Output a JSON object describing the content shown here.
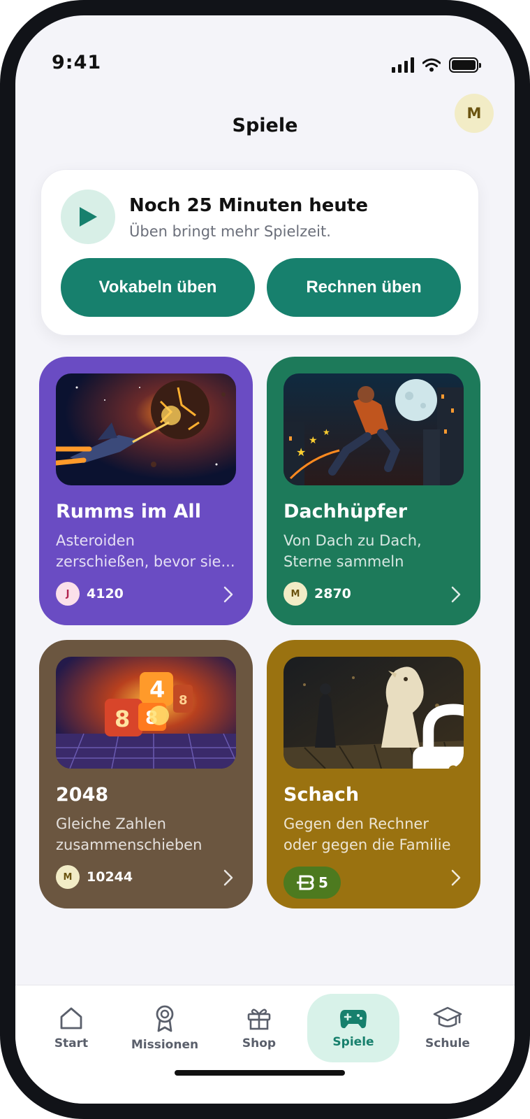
{
  "status_bar": {
    "time": "9:41"
  },
  "header": {
    "title": "Spiele",
    "avatar_initial": "M"
  },
  "time_card": {
    "title": "Noch 25 Minuten heute",
    "subtitle": "Üben bringt mehr Spielzeit.",
    "buttons": [
      {
        "label": "Vokabeln üben"
      },
      {
        "label": "Rechnen üben"
      }
    ]
  },
  "games": [
    {
      "title": "Rumms im All",
      "desc_line1": "Asteroiden",
      "desc_line2": "zerschießen, bevor sie...",
      "score_avatar": "J",
      "score": "4120",
      "color": "#6a4cc3"
    },
    {
      "title": "Dachhüpfer",
      "desc_line1": "Von Dach zu Dach,",
      "desc_line2": "Sterne sammeln",
      "score_avatar": "M",
      "score": "2870",
      "color": "#1d7a5a"
    },
    {
      "title": "2048",
      "desc_line1": "Gleiche Zahlen",
      "desc_line2": "zusammenschieben",
      "score_avatar": "M",
      "score": "10244",
      "color": "#6b5640"
    },
    {
      "title": "Schach",
      "desc_line1": "Gegen den Rechner",
      "desc_line2": "oder gegen die Familie",
      "locked": true,
      "price": "5",
      "color": "#9a7210"
    }
  ],
  "nav": {
    "items": [
      {
        "label": "Start",
        "icon": "home-icon"
      },
      {
        "label": "Missionen",
        "icon": "medal-icon"
      },
      {
        "label": "Shop",
        "icon": "gift-icon"
      },
      {
        "label": "Spiele",
        "icon": "gamepad-icon",
        "active": true
      },
      {
        "label": "Schule",
        "icon": "graduation-cap-icon"
      }
    ]
  },
  "colors": {
    "accent": "#17806d",
    "accent_soft": "#d8f2e9",
    "background": "#f4f4f9"
  }
}
